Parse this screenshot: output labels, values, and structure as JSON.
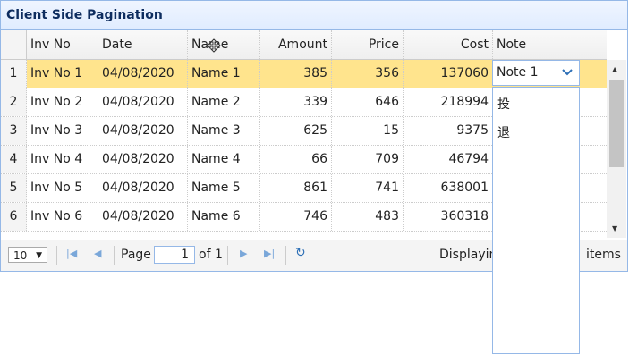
{
  "panel": {
    "title": "Client Side Pagination"
  },
  "columns": {
    "inv_no": "Inv No",
    "date": "Date",
    "name": "Name",
    "amount": "Amount",
    "price": "Price",
    "cost": "Cost",
    "note": "Note"
  },
  "rows": [
    {
      "num": "1",
      "inv": "Inv No 1",
      "date": "04/08/2020",
      "name": "Name 1",
      "amount": "385",
      "price": "356",
      "cost": "137060"
    },
    {
      "num": "2",
      "inv": "Inv No 2",
      "date": "04/08/2020",
      "name": "Name 2",
      "amount": "339",
      "price": "646",
      "cost": "218994"
    },
    {
      "num": "3",
      "inv": "Inv No 3",
      "date": "04/08/2020",
      "name": "Name 3",
      "amount": "625",
      "price": "15",
      "cost": "9375"
    },
    {
      "num": "4",
      "inv": "Inv No 4",
      "date": "04/08/2020",
      "name": "Name 4",
      "amount": "66",
      "price": "709",
      "cost": "46794"
    },
    {
      "num": "5",
      "inv": "Inv No 5",
      "date": "04/08/2020",
      "name": "Name 5",
      "amount": "861",
      "price": "741",
      "cost": "638001"
    },
    {
      "num": "6",
      "inv": "Inv No 6",
      "date": "04/08/2020",
      "name": "Name 6",
      "amount": "746",
      "price": "483",
      "cost": "360318"
    }
  ],
  "editor": {
    "value": "Note 1"
  },
  "dropdown": {
    "items": [
      "投",
      "退"
    ]
  },
  "pager": {
    "page_size": "10",
    "page_label": "Page",
    "page_value": "1",
    "of_label": "of 1",
    "displaying": "Displayin",
    "items_label": "items"
  },
  "colors": {
    "selected_row": "#FFE48D",
    "border_accent": "#95B8E7",
    "header_text": "#0E2D5F"
  }
}
